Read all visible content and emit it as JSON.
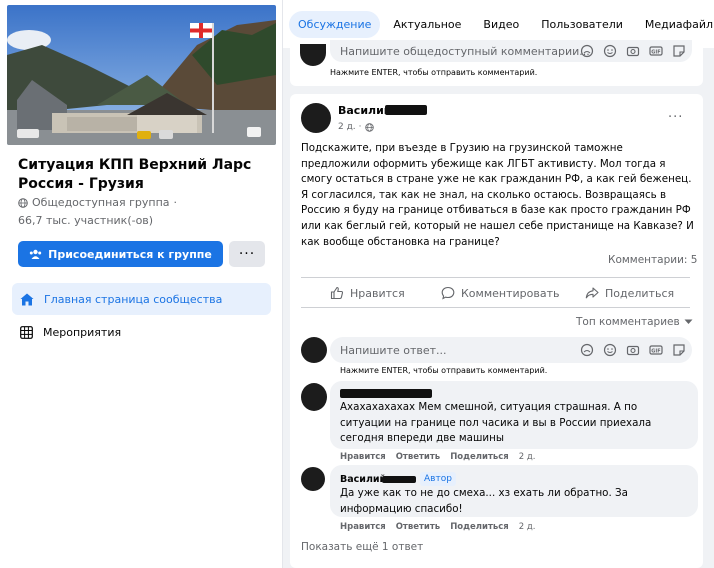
{
  "group": {
    "title": "Ситуация КПП Верхний Ларс Россия - Грузия",
    "privacy": "Общедоступная группа",
    "members": "66,7 тыс. участник(-ов)",
    "join_label": "Присоединиться к группе",
    "more_label": "···"
  },
  "nav": {
    "home": "Главная страница сообщества",
    "events": "Мероприятия"
  },
  "tabs": [
    "Обсуждение",
    "Актуальное",
    "Видео",
    "Пользователи",
    "Медиафайлы"
  ],
  "top_comment_box": {
    "placeholder": "Напишите общедоступный комментарии...",
    "hint": "Нажмите ENTER, чтобы отправить комментарий."
  },
  "post": {
    "author": "Василий",
    "time": "2 д.",
    "text": "Подскажите, при въезде в Грузию на грузинской таможне предложили оформить убежище как ЛГБТ активисту. Мол тогда я смогу остаться в стране уже не как гражданин РФ, а как гей беженец. Я согласился, так как не знал, на сколько остаюсь. Возвращаясь в Россию я буду на границе отбиваться в базе как просто гражданин РФ или как беглый гей, который не нашел себе пристанище на Кавказе? И как вообще обстановка на границе?",
    "comments_count": "Комментарии: 5",
    "like_label": "Нравится",
    "comment_label": "Комментировать",
    "share_label": "Поделиться",
    "more": "···"
  },
  "sort_label": "Топ комментариев",
  "reply_box": {
    "placeholder": "Напишите ответ...",
    "hint": "Нажмите ENTER, чтобы отправить комментарий."
  },
  "comments": [
    {
      "text": "Ахахахахахах Мем смешной, ситуация страшная. А по ситуации на границе пол часика и вы в России приехала сегодня впереди две машины",
      "like": "Нравится",
      "reply": "Ответить",
      "share": "Поделиться",
      "time": "2 д."
    },
    {
      "author": "Василий",
      "badge": "Автор",
      "text": "Да уже как то не до смеха... хз ехать ли обратно. За информацию спасибо!",
      "like": "Нравится",
      "reply": "Ответить",
      "share": "Поделиться",
      "time": "2 д."
    }
  ],
  "more_replies": "Показать ещё 1 ответ"
}
